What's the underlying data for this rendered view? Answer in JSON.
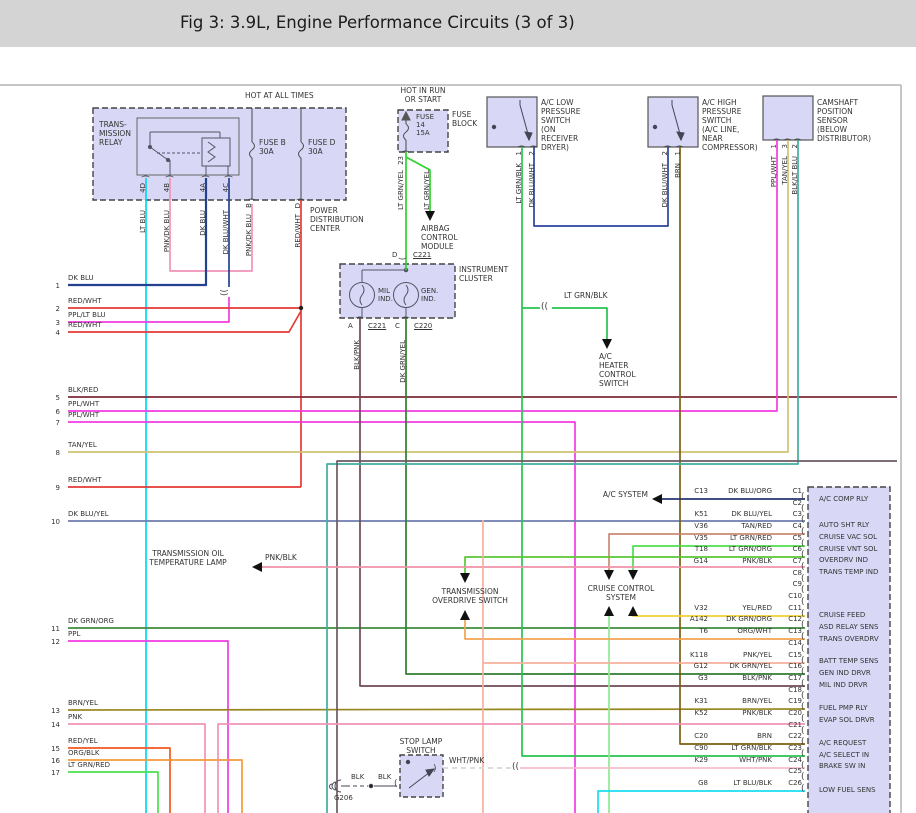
{
  "header": {
    "title": "Fig 3: 3.9L, Engine Performance Circuits (3 of 3)"
  },
  "colors": {
    "titlebar": "#d4d4d4",
    "component_fill": "#d8d8f6",
    "wire_red": "#e53935",
    "wire_cyan": "#00d8f0",
    "wire_magenta": "#f23be3"
  },
  "pdc": {
    "hot": "HOT AT ALL TIMES",
    "name": "POWER\nDISTRIBUTION\nCENTER",
    "relay": "TRANS-\nMISSION\nRELAY",
    "fuse_b": "FUSE B\n30A",
    "fuse_d": "FUSE D\n30A",
    "pin_4d": "4D",
    "pin_4b": "4B",
    "pin_4a": "4A",
    "pin_4c": "4C",
    "w_4d": "LT BLU",
    "w_4b": "PNK/DK BLU",
    "w_4a": "DK BLU",
    "w_4c": "DK BLU/WHT",
    "pin_b": "B",
    "w_b": "PNK/DK BLU",
    "pin_d": "D",
    "w_d": "RED/WHT"
  },
  "fuseblock": {
    "hot": "HOT IN RUN\nOR START",
    "fuse": "FUSE\n14\n15A",
    "name": "FUSE\nBLOCK",
    "pin": "23",
    "wire1": "LT GRN/YEL",
    "wire2": "LT GRN/YEL",
    "airbag": "AIRBAG\nCONTROL\nMODULE"
  },
  "ac_low": {
    "name": "A/C LOW\nPRESSURE\nSWITCH\n(ON\nRECEIVER\nDRYER)",
    "pin1": "1",
    "pin2": "2",
    "w1": "LT GRN/BLK",
    "w2": "DK BLU/WHT"
  },
  "ac_high": {
    "name": "A/C HIGH\nPRESSURE\nSWITCH\n(A/C LINE,\nNEAR\nCOMPRESSOR)",
    "pin2": "2",
    "pin1": "1",
    "w2": "DK BLU/WHT",
    "w1": "BRN"
  },
  "cam": {
    "name": "CAMSHAFT\nPOSITION\nSENSOR\n(BELOW\nDISTRIBUTOR)",
    "pin1": "1",
    "pin3": "3",
    "pin2": "2",
    "w1": "PPL/WHT",
    "w3": "TAN/YEL",
    "w2": "BLK/LT BLU"
  },
  "cluster": {
    "name": "INSTRUMENT\nCLUSTER",
    "mil": "MIL\nIND.",
    "gen": "GEN.\nIND.",
    "pin_d": "D",
    "conn_d": "C221",
    "pin_a": "A",
    "conn_a": "C221",
    "pin_c": "C",
    "conn_c": "C220",
    "w_a": "BLK/PNK",
    "w_c": "DK GRN/YEL"
  },
  "branches": {
    "ltgrnblk": "LT GRN/BLK",
    "ac_heater": "A/C\nHEATER\nCONTROL\nSWITCH",
    "ac_system": "A/C SYSTEM",
    "trans_lamp": "TRANSMISSION OIL\nTEMPERATURE LAMP",
    "trans_lamp_wire": "PNK/BLK",
    "trans_od": "TRANSMISSION\nOVERDRIVE SWITCH",
    "cruise": "CRUISE CONTROL\nSYSTEM"
  },
  "stoplamp": {
    "name": "STOP LAMP\nSWITCH",
    "blk1": "BLK",
    "blk2": "BLK",
    "gnd": "G206",
    "wire": "WHT/PNK"
  },
  "left_rows": [
    {
      "n": "1",
      "color": "DK BLU"
    },
    {
      "n": "2",
      "color": "RED/WHT"
    },
    {
      "n": "3",
      "color": "PPL/LT BLU"
    },
    {
      "n": "4",
      "color": "RED/WHT"
    },
    {
      "n": "5",
      "color": "BLK/RED"
    },
    {
      "n": "6",
      "color": "PPL/WHT"
    },
    {
      "n": "7",
      "color": "PPL/WHT"
    },
    {
      "n": "8",
      "color": "TAN/YEL"
    },
    {
      "n": "9",
      "color": "RED/WHT"
    },
    {
      "n": "10",
      "color": "DK BLU/YEL"
    },
    {
      "n": "11",
      "color": "DK GRN/ORG"
    },
    {
      "n": "12",
      "color": "PPL"
    },
    {
      "n": "13",
      "color": "BRN/YEL"
    },
    {
      "n": "14",
      "color": "PNK"
    },
    {
      "n": "15",
      "color": "RED/YEL"
    },
    {
      "n": "16",
      "color": "ORG/BLK"
    },
    {
      "n": "17",
      "color": "LT GRN/RED"
    }
  ],
  "pcm": {
    "rows": [
      {
        "pin": "C1",
        "code": "C13",
        "color": "DK BLU/ORG"
      },
      {
        "pin": "C2",
        "code": "",
        "color": ""
      },
      {
        "pin": "C3",
        "code": "K51",
        "color": "DK BLU/YEL"
      },
      {
        "pin": "C4",
        "code": "V36",
        "color": "TAN/RED"
      },
      {
        "pin": "C5",
        "code": "V35",
        "color": "LT GRN/RED"
      },
      {
        "pin": "C6",
        "code": "T18",
        "color": "LT GRN/ORG"
      },
      {
        "pin": "C7",
        "code": "G14",
        "color": "PNK/BLK"
      },
      {
        "pin": "C8",
        "code": "",
        "color": ""
      },
      {
        "pin": "C9",
        "code": "",
        "color": ""
      },
      {
        "pin": "C10",
        "code": "",
        "color": ""
      },
      {
        "pin": "C11",
        "code": "V32",
        "color": "YEL/RED"
      },
      {
        "pin": "C12",
        "code": "A142",
        "color": "DK GRN/ORG"
      },
      {
        "pin": "C13",
        "code": "T6",
        "color": "ORG/WHT"
      },
      {
        "pin": "C14",
        "code": "",
        "color": ""
      },
      {
        "pin": "C15",
        "code": "K118",
        "color": "PNK/YEL"
      },
      {
        "pin": "C16",
        "code": "G12",
        "color": "DK GRN/YEL"
      },
      {
        "pin": "C17",
        "code": "G3",
        "color": "BLK/PNK"
      },
      {
        "pin": "C18",
        "code": "",
        "color": ""
      },
      {
        "pin": "C19",
        "code": "K31",
        "color": "BRN/YEL"
      },
      {
        "pin": "C20",
        "code": "K52",
        "color": "PNK/BLK"
      },
      {
        "pin": "C21",
        "code": "",
        "color": ""
      },
      {
        "pin": "C22",
        "code": "C20",
        "color": "BRN"
      },
      {
        "pin": "C23",
        "code": "C90",
        "color": "LT GRN/BLK"
      },
      {
        "pin": "C24",
        "code": "K29",
        "color": "WHT/PNK"
      },
      {
        "pin": "C25",
        "code": "",
        "color": ""
      },
      {
        "pin": "C26",
        "code": "G8",
        "color": "LT BLU/BLK"
      }
    ],
    "labels": [
      "A/C COMP RLY",
      "AUTO SHT RLY",
      "CRUISE VAC SOL",
      "CRUISE VNT SOL",
      "OVERDRV IND",
      "TRANS TEMP IND",
      "CRUISE FEED",
      "ASD RELAY SENS",
      "TRANS OVERDRV",
      "BATT TEMP SENS",
      "GEN IND DRVR",
      "MIL IND DRVR",
      "FUEL PMP RLY",
      "EVAP SOL DRVR",
      "A/C REQUEST",
      "A/C SELECT IN",
      "BRAKE SW IN",
      "LOW FUEL SENS"
    ]
  }
}
